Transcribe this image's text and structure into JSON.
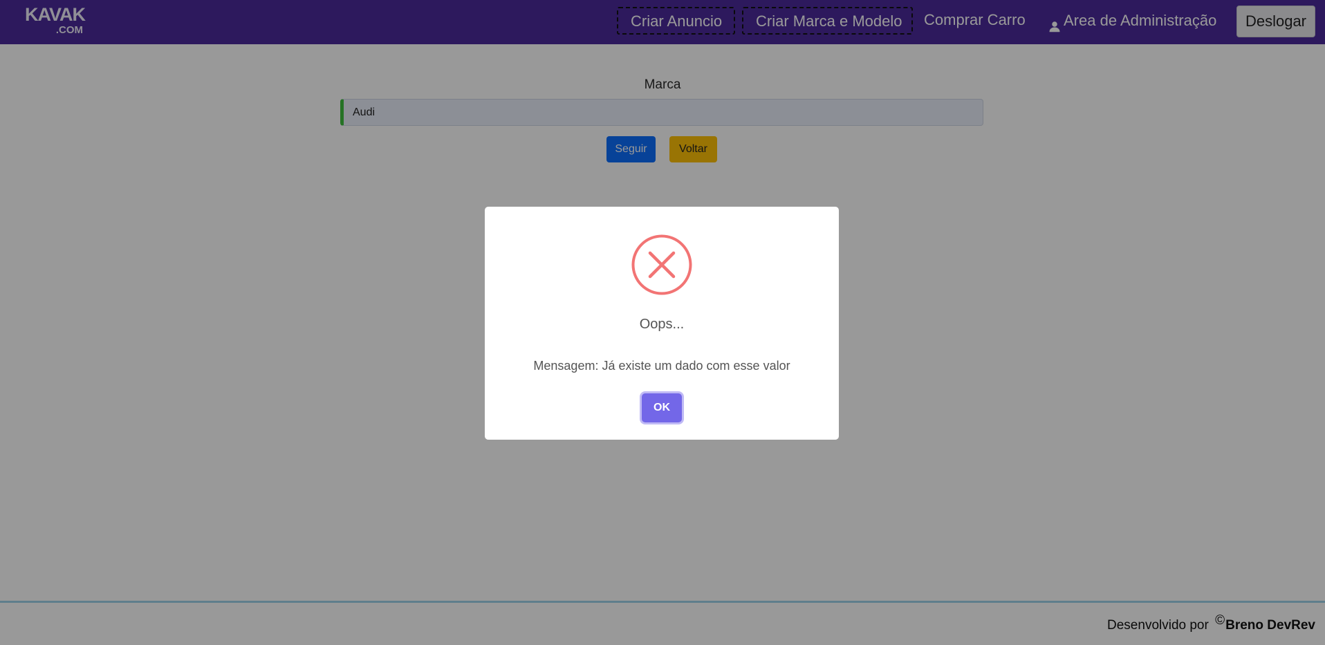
{
  "header": {
    "logo_top": "KAVAK",
    "logo_bottom": ".COM",
    "nav": {
      "criar_anuncio": "Criar Anuncio",
      "criar_marca_modelo": "Criar Marca e Modelo",
      "comprar_carro": "Comprar Carro",
      "area_admin": "Area de Administração"
    },
    "logout_label": "Deslogar"
  },
  "form": {
    "label": "Marca",
    "brand_value": "Audi",
    "next_label": "Seguir",
    "back_label": "Voltar"
  },
  "footer": {
    "prefix": "Desenvolvido por",
    "copyright_symbol": "©",
    "author": "Breno DevRev"
  },
  "alert": {
    "icon": "error-x-icon",
    "title": "Oops...",
    "message": "Mensagem: Já existe um dado com esse valor",
    "ok_label": "OK"
  },
  "colors": {
    "header_bg": "#4b2b9b",
    "primary": "#0d6efd",
    "warning": "#ffc107",
    "error": "#f27474",
    "ok_button": "#7367e8"
  }
}
